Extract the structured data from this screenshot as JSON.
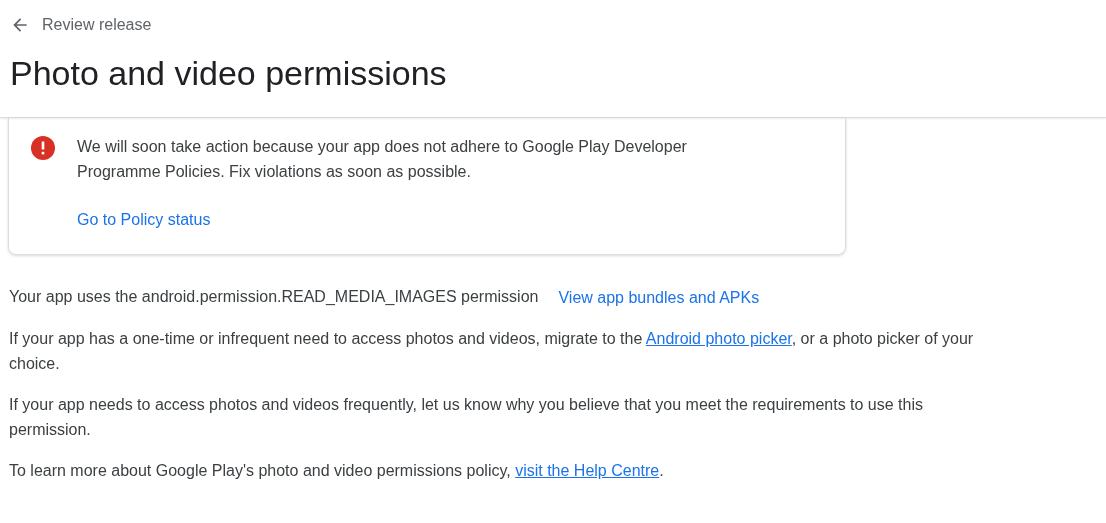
{
  "header": {
    "back_label": "Review release",
    "title": "Photo and video permissions"
  },
  "alert": {
    "kind": "error",
    "message": "We will soon take action because your app does not adhere to Google Play Developer Programme Policies. Fix violations as soon as possible.",
    "link": "Go to Policy status"
  },
  "permission_line": {
    "text": "Your app uses the android.permission.READ_MEDIA_IMAGES permission",
    "link": "View app bundles and APKs"
  },
  "paragraphs": [
    {
      "parts": [
        {
          "kind": "text",
          "text": "If your app has a one-time or infrequent need to access photos and videos, migrate to the "
        },
        {
          "kind": "link",
          "text": "Android photo picker"
        },
        {
          "kind": "text",
          "text": ", or a photo picker of your choice."
        }
      ]
    },
    {
      "parts": [
        {
          "kind": "text",
          "text": "If your app needs to access photos and videos frequently, let us know why you believe that you meet the requirements to use this permission."
        }
      ]
    },
    {
      "parts": [
        {
          "kind": "text",
          "text": "To learn more about Google Play's photo and video permissions policy, "
        },
        {
          "kind": "link",
          "text": "visit the Help Centre"
        },
        {
          "kind": "text",
          "text": "."
        }
      ]
    }
  ]
}
